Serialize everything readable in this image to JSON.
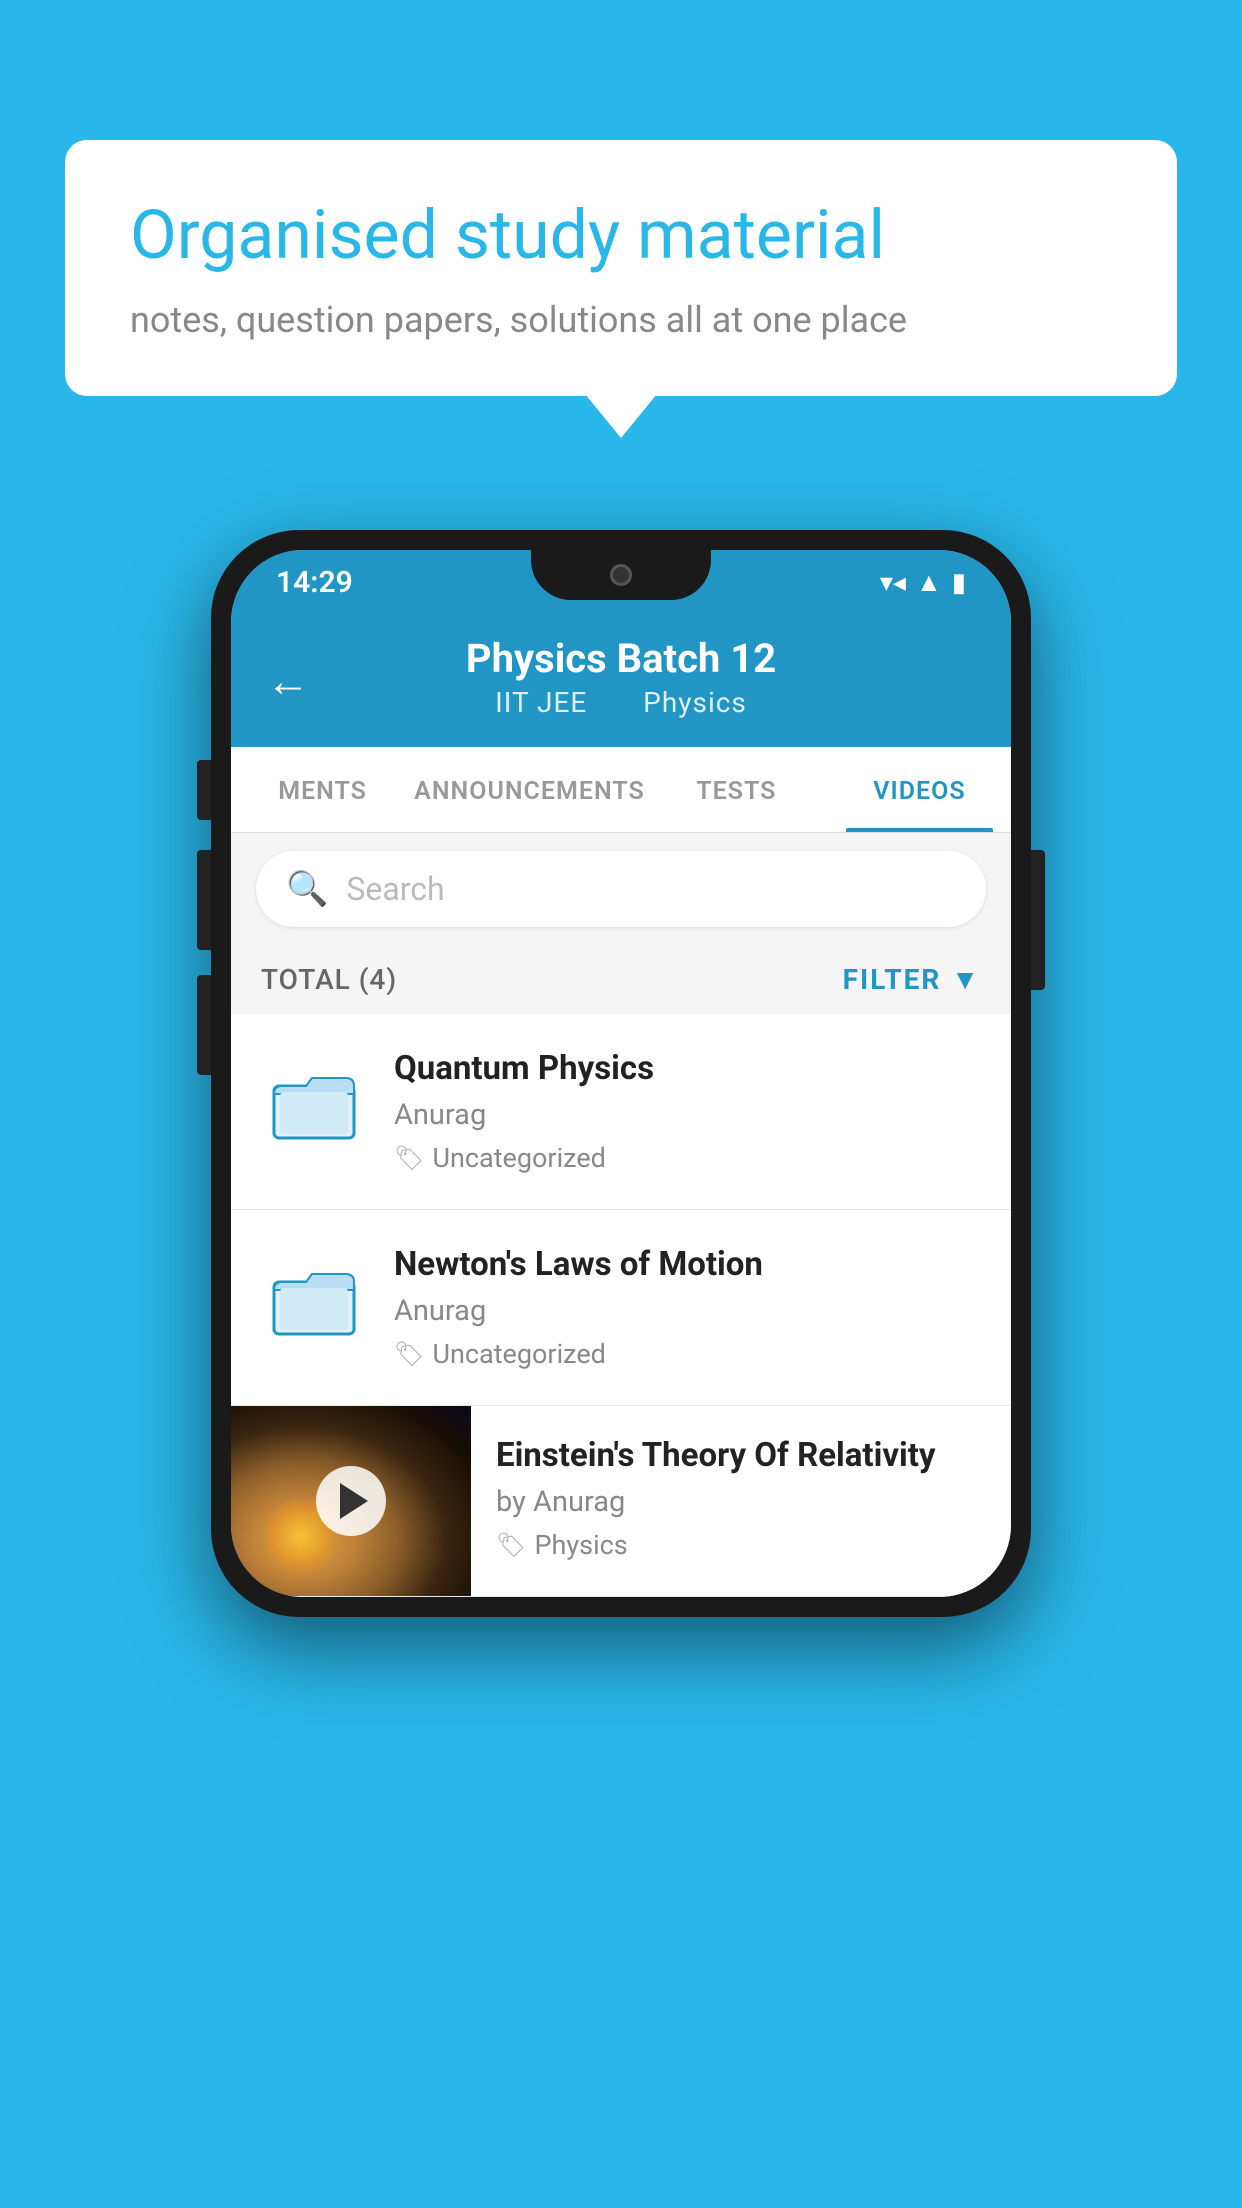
{
  "background_color": "#29b6e8",
  "bubble": {
    "title": "Organised study material",
    "subtitle": "notes, question papers, solutions all at one place"
  },
  "phone": {
    "status_bar": {
      "time": "14:29",
      "icons": [
        "wifi",
        "signal",
        "battery"
      ]
    },
    "header": {
      "title": "Physics Batch 12",
      "subtitle_part1": "IIT JEE",
      "subtitle_part2": "Physics",
      "back_label": "←"
    },
    "tabs": [
      {
        "label": "MENTS",
        "active": false
      },
      {
        "label": "ANNOUNCEMENTS",
        "active": false
      },
      {
        "label": "TESTS",
        "active": false
      },
      {
        "label": "VIDEOS",
        "active": true
      }
    ],
    "search": {
      "placeholder": "Search"
    },
    "filter": {
      "total_label": "TOTAL (4)",
      "filter_label": "FILTER"
    },
    "videos": [
      {
        "id": 1,
        "title": "Quantum Physics",
        "author": "Anurag",
        "tag": "Uncategorized",
        "type": "folder",
        "has_thumb": false
      },
      {
        "id": 2,
        "title": "Newton's Laws of Motion",
        "author": "Anurag",
        "tag": "Uncategorized",
        "type": "folder",
        "has_thumb": false
      },
      {
        "id": 3,
        "title": "Einstein's Theory Of Relativity",
        "author": "by Anurag",
        "tag": "Physics",
        "type": "video",
        "has_thumb": true
      }
    ]
  }
}
